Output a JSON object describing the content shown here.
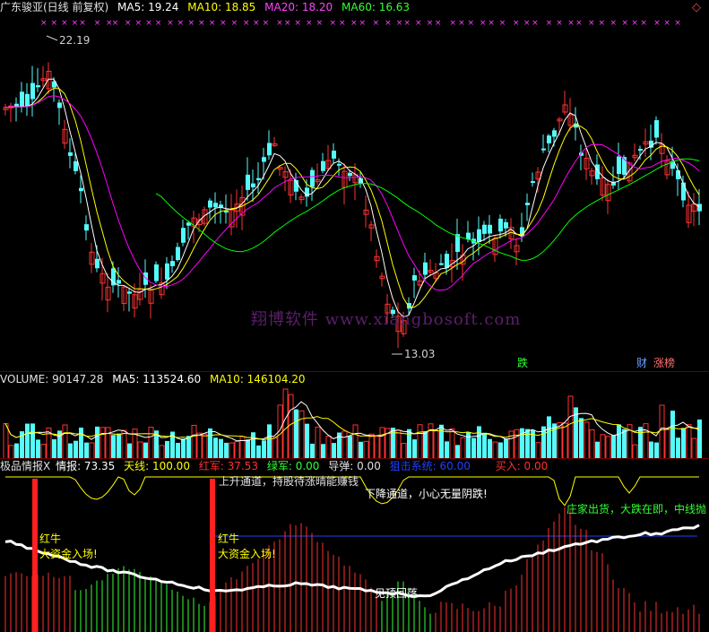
{
  "price_header": {
    "title": "广东骏亚(日线 前复权)",
    "ma5": "MA5: 19.24",
    "ma10": "MA10: 18.85",
    "ma20": "MA20: 18.20",
    "ma60": "MA60: 16.63"
  },
  "price_annotations": {
    "high_label": "22.19",
    "low_label": "13.03",
    "watermark": "翔博软件 www.xiangbosoft.com",
    "tag_die": "跌",
    "tag_cai": "财",
    "tag_zhangbang": "涨榜"
  },
  "volume_header": {
    "volume": "VOLUME: 90147.28",
    "ma5": "MA5: 113524.60",
    "ma10": "MA10: 146104.20"
  },
  "indicator_header": {
    "name": "极品情报X",
    "qingbao": "情报: 73.35",
    "tianxian": "天线: 100.00",
    "hongjun": "红军: 37.53",
    "lvjun": "绿军: 0.00",
    "daotan": "导弹: 0.00",
    "jiji": "狙击系统: 60.00",
    "mairu": "买入: 0.00"
  },
  "indicator_annotations": {
    "red_bull_1": "红牛",
    "big_money_1": "大资金入场!",
    "red_bull_2": "红牛",
    "big_money_2": "大资金入场!",
    "top_partial": "上升通道，持股待涨晴能赚钱",
    "down_channel": "下降通道，小心无量阴跌!",
    "dealer_out": "庄家出货，大跌在即，中线抛",
    "callback": "见顶回落"
  },
  "colors": {
    "up": "#ff3232",
    "down": "#54fcfc",
    "ma5": "#ffffff",
    "ma10": "#ffff00",
    "ma20": "#ff00ff",
    "ma60": "#00ff00"
  }
}
